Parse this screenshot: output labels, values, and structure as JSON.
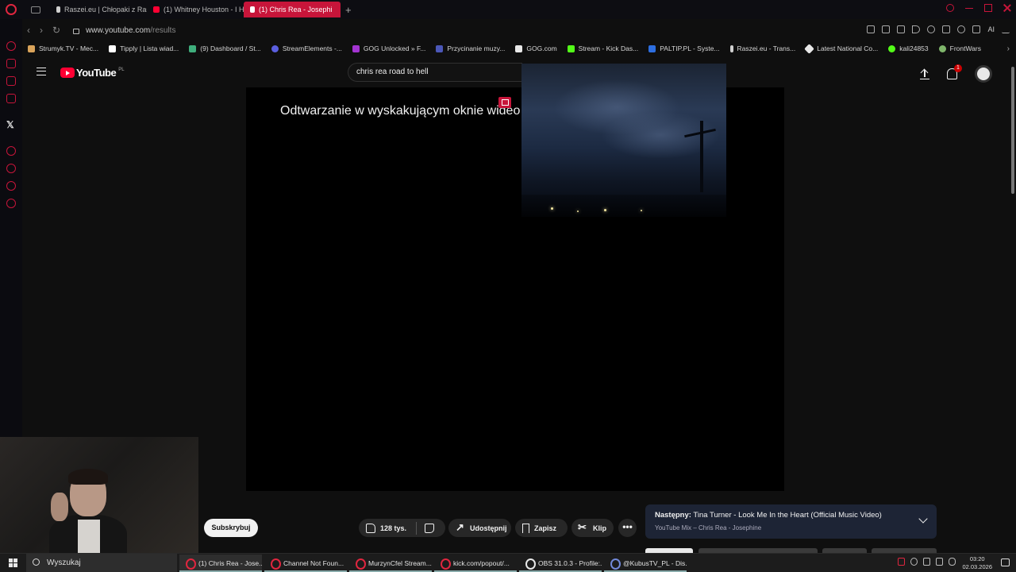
{
  "browser": {
    "tabs": [
      {
        "label": "Raszei.eu | Chłopaki z Ras",
        "icon": "person-silhouette-icon",
        "color": "#d0d0d0"
      },
      {
        "label": "(1) Whitney Houston - I Ha",
        "icon": "youtube-icon",
        "color": "#ff0033"
      },
      {
        "label": "(1) Chris Rea - Josephi",
        "icon": "speaker-icon",
        "color": "#ffffff",
        "active": true
      }
    ],
    "url_host": "www.youtube.com",
    "url_path": "/results",
    "ai_label": "AI",
    "bookmarks": [
      {
        "label": "Strumyk.TV - Mec...",
        "color": "#d9a35a"
      },
      {
        "label": "Tipply | Lista wiad...",
        "color": "#ffffff"
      },
      {
        "label": "(9) Dashboard / St...",
        "color": "#3fae7c"
      },
      {
        "label": "StreamElements -...",
        "color": "#5b5fe0"
      },
      {
        "label": "GOG Unlocked » F...",
        "color": "#a334d1"
      },
      {
        "label": "Przycinanie muzy...",
        "color": "#4b57b8"
      },
      {
        "label": "GOG.com",
        "color": "#e8e8e8"
      },
      {
        "label": "Stream - Kick Das...",
        "color": "#53fc18"
      },
      {
        "label": "PALTIP.PL - Syste...",
        "color": "#2d6ee0"
      },
      {
        "label": "Raszei.eu - Trans...",
        "color": "#d0d0d0"
      },
      {
        "label": "Latest National Co...",
        "color": "#e8e8e8"
      },
      {
        "label": "kali24853",
        "color": "#53fc18"
      },
      {
        "label": "FrontWars",
        "color": "#7fb56b"
      }
    ]
  },
  "youtube": {
    "logo_text": "YouTube",
    "region": "PL",
    "search_query": "chris rea road to hell",
    "notification_count": "1",
    "popup_message": "Odtwarzanie w wyskakującym oknie wideo",
    "subscribe_label": "Subskrybuj",
    "like_count": "128 tys.",
    "share_label": "Udostępnij",
    "save_label": "Zapisz",
    "clip_label": "Klip",
    "more_label": "•••",
    "next": {
      "prefix": "Następny:",
      "title": "Tina Turner - Look Me In the Heart (Official Music Video)",
      "subtitle": "YouTube Mix – Chris Rea - Josephine"
    }
  },
  "taskbar": {
    "search_placeholder": "Wyszukaj",
    "apps": [
      {
        "label": "(1) Chris Rea - Jose...",
        "icon": "opera-icon",
        "color": "#e0263f"
      },
      {
        "label": "Channel Not Foun...",
        "icon": "opera-icon",
        "color": "#e0263f"
      },
      {
        "label": "MurzynCfel Stream...",
        "icon": "opera-icon",
        "color": "#e0263f"
      },
      {
        "label": "kick.com/popout/...",
        "icon": "opera-icon",
        "color": "#e0263f"
      },
      {
        "label": "OBS 31.0.3 - Profile:...",
        "icon": "obs-icon",
        "color": "#e8e8e8"
      },
      {
        "label": "@KubusTV_PL - Dis...",
        "icon": "discord-icon",
        "color": "#7289da"
      }
    ],
    "time": "03:20",
    "date": "02.03.2026"
  }
}
